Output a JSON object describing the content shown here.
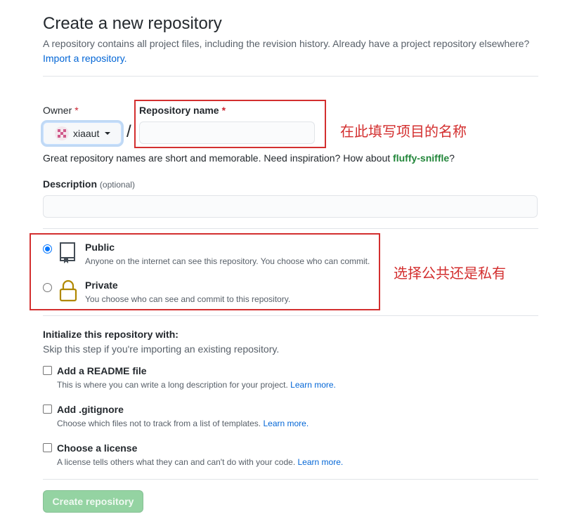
{
  "header": {
    "title": "Create a new repository",
    "subtitle": "A repository contains all project files, including the revision history. Already have a project repository elsewhere?",
    "import_link": "Import a repository."
  },
  "owner": {
    "label": "Owner",
    "required": "*",
    "value": "xiaaut",
    "avatar_icon": "identicon-avatar"
  },
  "separator": "/",
  "repo_name": {
    "label": "Repository name",
    "required": "*",
    "value": "",
    "annotation": "在此填写项目的名称"
  },
  "hint": {
    "text": "Great repository names are short and memorable. Need inspiration? How about ",
    "suggestion": "fluffy-sniffle",
    "end": "?"
  },
  "description": {
    "label": "Description",
    "optional": "(optional)",
    "value": ""
  },
  "visibility": {
    "annotation": "选择公共还是私有",
    "options": [
      {
        "title": "Public",
        "desc": "Anyone on the internet can see this repository. You choose who can commit.",
        "checked": true,
        "icon": "repo-book-icon"
      },
      {
        "title": "Private",
        "desc": "You choose who can see and commit to this repository.",
        "checked": false,
        "icon": "lock-icon"
      }
    ]
  },
  "init": {
    "title": "Initialize this repository with:",
    "subtitle": "Skip this step if you're importing an existing repository.",
    "options": [
      {
        "title": "Add a README file",
        "desc": "This is where you can write a long description for your project.",
        "link": "Learn more."
      },
      {
        "title": "Add .gitignore",
        "desc": "Choose which files not to track from a list of templates.",
        "link": "Learn more."
      },
      {
        "title": "Choose a license",
        "desc": "A license tells others what they can and can't do with your code.",
        "link": "Learn more."
      }
    ]
  },
  "submit": {
    "label": "Create repository"
  },
  "colors": {
    "accent": "#0366d6",
    "annotation": "#d32f2f",
    "button_disabled": "#94d3a2",
    "suggestion": "#22863a"
  }
}
